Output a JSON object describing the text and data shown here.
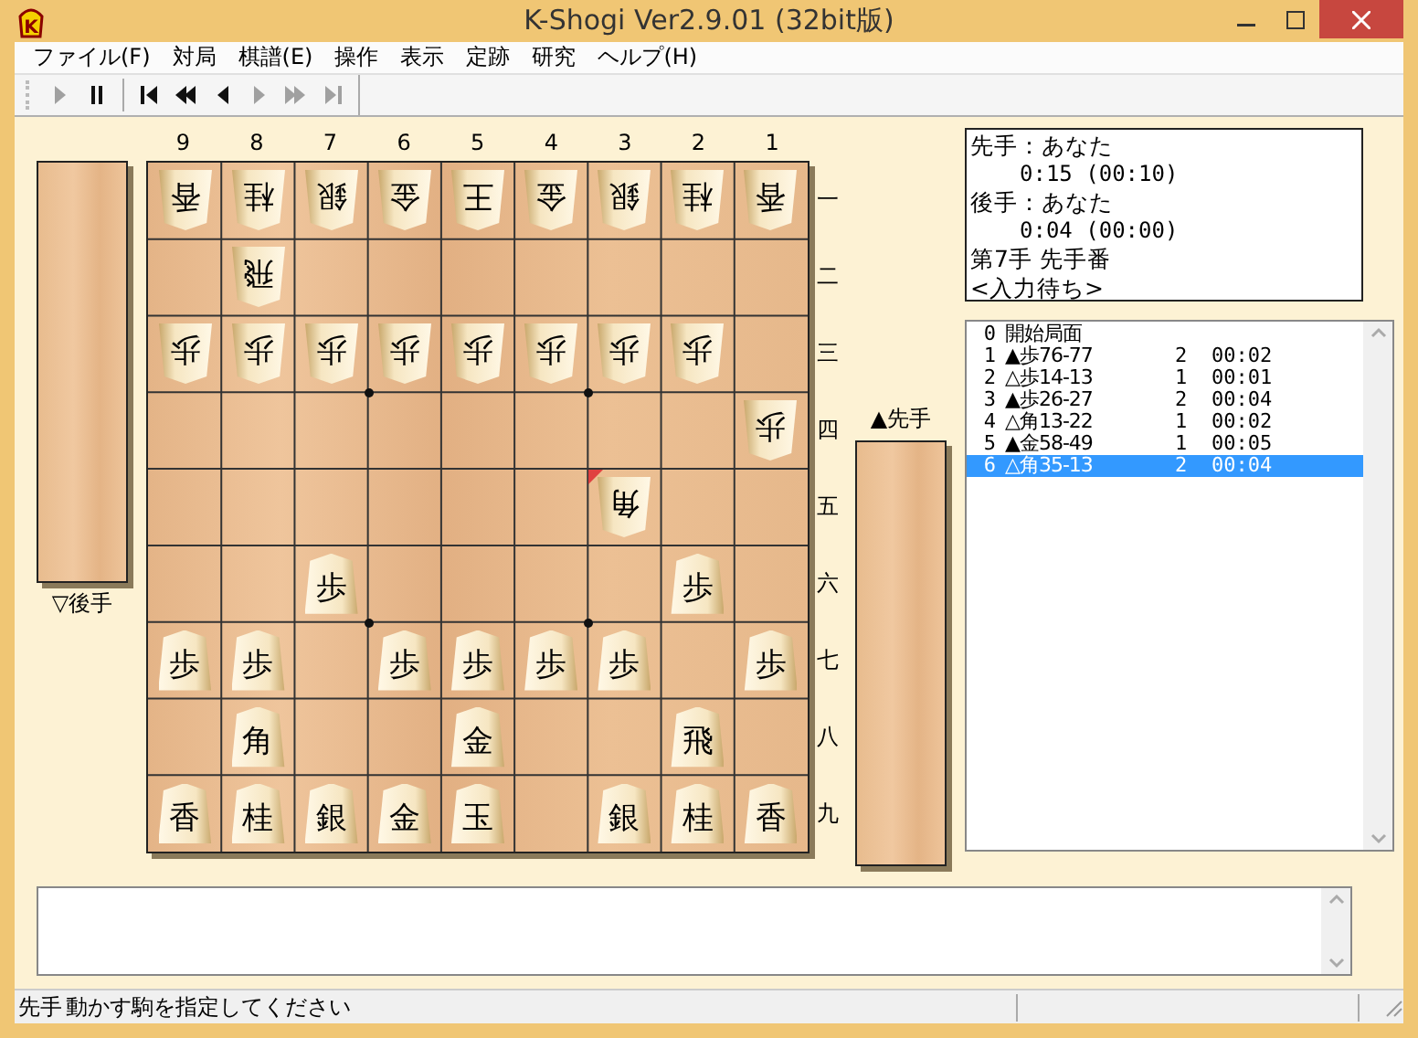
{
  "window": {
    "logo": "K",
    "title": "K-Shogi Ver2.9.01 (32bit版)"
  },
  "menu": [
    "ファイル(F)",
    "対局",
    "棋譜(E)",
    "操作",
    "表示",
    "定跡",
    "研究",
    "ヘルプ(H)"
  ],
  "toolbar": [
    {
      "kind": "play",
      "disabled": true
    },
    {
      "kind": "pause",
      "disabled": false
    },
    {
      "kind": "sep"
    },
    {
      "kind": "first",
      "disabled": false
    },
    {
      "kind": "rewind",
      "disabled": false
    },
    {
      "kind": "back",
      "disabled": false
    },
    {
      "kind": "forward",
      "disabled": true
    },
    {
      "kind": "fastforward",
      "disabled": true
    },
    {
      "kind": "last",
      "disabled": true
    }
  ],
  "file_labels": [
    "9",
    "8",
    "7",
    "6",
    "5",
    "4",
    "3",
    "2",
    "1"
  ],
  "rank_labels": [
    "一",
    "二",
    "三",
    "四",
    "五",
    "六",
    "七",
    "八",
    "九"
  ],
  "gote_stand": {
    "label": "▽後手"
  },
  "sente_stand": {
    "label": "▲先手"
  },
  "board": [
    [
      {
        "occupied": true,
        "piece": "香",
        "gote": true
      },
      {
        "occupied": true,
        "piece": "桂",
        "gote": true
      },
      {
        "occupied": true,
        "piece": "銀",
        "gote": true
      },
      {
        "occupied": true,
        "piece": "金",
        "gote": true
      },
      {
        "occupied": true,
        "piece": "王",
        "gote": true
      },
      {
        "occupied": true,
        "piece": "金",
        "gote": true
      },
      {
        "occupied": true,
        "piece": "銀",
        "gote": true
      },
      {
        "occupied": true,
        "piece": "桂",
        "gote": true
      },
      {
        "occupied": true,
        "piece": "香",
        "gote": true
      }
    ],
    [
      {
        "occupied": false
      },
      {
        "occupied": true,
        "piece": "飛",
        "gote": true
      },
      {
        "occupied": false
      },
      {
        "occupied": false
      },
      {
        "occupied": false
      },
      {
        "occupied": false
      },
      {
        "occupied": false
      },
      {
        "occupied": false
      },
      {
        "occupied": false
      }
    ],
    [
      {
        "occupied": true,
        "piece": "歩",
        "gote": true
      },
      {
        "occupied": true,
        "piece": "歩",
        "gote": true
      },
      {
        "occupied": true,
        "piece": "歩",
        "gote": true
      },
      {
        "occupied": true,
        "piece": "歩",
        "gote": true
      },
      {
        "occupied": true,
        "piece": "歩",
        "gote": true
      },
      {
        "occupied": true,
        "piece": "歩",
        "gote": true
      },
      {
        "occupied": true,
        "piece": "歩",
        "gote": true
      },
      {
        "occupied": true,
        "piece": "歩",
        "gote": true
      },
      {
        "occupied": false
      }
    ],
    [
      {
        "occupied": false
      },
      {
        "occupied": false
      },
      {
        "occupied": false
      },
      {
        "occupied": false
      },
      {
        "occupied": false
      },
      {
        "occupied": false
      },
      {
        "occupied": false
      },
      {
        "occupied": false
      },
      {
        "occupied": true,
        "piece": "歩",
        "gote": true
      }
    ],
    [
      {
        "occupied": false
      },
      {
        "occupied": false
      },
      {
        "occupied": false
      },
      {
        "occupied": false
      },
      {
        "occupied": false
      },
      {
        "occupied": false
      },
      {
        "occupied": true,
        "piece": "角",
        "gote": true,
        "last_move": true
      },
      {
        "occupied": false
      },
      {
        "occupied": false
      }
    ],
    [
      {
        "occupied": false
      },
      {
        "occupied": false
      },
      {
        "occupied": true,
        "piece": "歩",
        "gote": false
      },
      {
        "occupied": false
      },
      {
        "occupied": false
      },
      {
        "occupied": false
      },
      {
        "occupied": false
      },
      {
        "occupied": true,
        "piece": "歩",
        "gote": false
      },
      {
        "occupied": false
      }
    ],
    [
      {
        "occupied": true,
        "piece": "歩",
        "gote": false
      },
      {
        "occupied": true,
        "piece": "歩",
        "gote": false
      },
      {
        "occupied": false
      },
      {
        "occupied": true,
        "piece": "歩",
        "gote": false
      },
      {
        "occupied": true,
        "piece": "歩",
        "gote": false
      },
      {
        "occupied": true,
        "piece": "歩",
        "gote": false
      },
      {
        "occupied": true,
        "piece": "歩",
        "gote": false
      },
      {
        "occupied": false
      },
      {
        "occupied": true,
        "piece": "歩",
        "gote": false
      }
    ],
    [
      {
        "occupied": false
      },
      {
        "occupied": true,
        "piece": "角",
        "gote": false
      },
      {
        "occupied": false
      },
      {
        "occupied": false
      },
      {
        "occupied": true,
        "piece": "金",
        "gote": false
      },
      {
        "occupied": false
      },
      {
        "occupied": false
      },
      {
        "occupied": true,
        "piece": "飛",
        "gote": false
      },
      {
        "occupied": false
      }
    ],
    [
      {
        "occupied": true,
        "piece": "香",
        "gote": false
      },
      {
        "occupied": true,
        "piece": "桂",
        "gote": false
      },
      {
        "occupied": true,
        "piece": "銀",
        "gote": false
      },
      {
        "occupied": true,
        "piece": "金",
        "gote": false
      },
      {
        "occupied": true,
        "piece": "玉",
        "gote": false
      },
      {
        "occupied": false
      },
      {
        "occupied": true,
        "piece": "銀",
        "gote": false
      },
      {
        "occupied": true,
        "piece": "桂",
        "gote": false
      },
      {
        "occupied": true,
        "piece": "香",
        "gote": false
      }
    ]
  ],
  "info": {
    "players": [
      {
        "name": "先手：あなた",
        "time": "0:15 (00:10)"
      },
      {
        "name": "後手：あなた",
        "time": "0:04 (00:00)"
      }
    ],
    "move_number": "第7手 先手番",
    "state": "<入力待ち>"
  },
  "moves": [
    {
      "number": "0",
      "move": "開始局面",
      "selected": false
    },
    {
      "number": "1",
      "move": "▲歩76-77",
      "column_3": "2",
      "time": "00:02",
      "selected": false
    },
    {
      "number": "2",
      "move": "△歩14-13",
      "column_3": "1",
      "time": "00:01",
      "selected": false
    },
    {
      "number": "3",
      "move": "▲歩26-27",
      "column_3": "2",
      "time": "00:04",
      "selected": false
    },
    {
      "number": "4",
      "move": "△角13-22",
      "column_3": "1",
      "time": "00:02",
      "selected": false
    },
    {
      "number": "5",
      "move": "▲金58-49",
      "column_3": "1",
      "time": "00:05",
      "selected": false
    },
    {
      "number": "6",
      "move": "△角35-13",
      "column_3": "2",
      "time": "00:04",
      "selected": true
    }
  ],
  "status_bar": {
    "turn": "先手",
    "message": "動かす駒を指定してください"
  }
}
